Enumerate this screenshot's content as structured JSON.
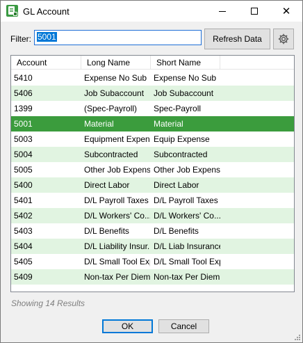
{
  "window": {
    "title": "GL Account",
    "icon": "gl-account-app-icon",
    "minimize_icon": "minimize-icon",
    "maximize_icon": "maximize-icon",
    "close_icon": "close-icon"
  },
  "filter": {
    "label": "Filter:",
    "value": "5001",
    "refresh_label": "Refresh Data",
    "settings_icon": "gear-icon"
  },
  "grid": {
    "columns": [
      "Account",
      "Long Name",
      "Short Name",
      ""
    ],
    "rows": [
      {
        "account": "5410",
        "long_name": "Expense No Sub",
        "short_name": "Expense No Sub"
      },
      {
        "account": "5406",
        "long_name": "Job Subaccount",
        "short_name": "Job Subaccount"
      },
      {
        "account": "1399",
        "long_name": "(Spec-Payroll)",
        "short_name": "Spec-Payroll"
      },
      {
        "account": "5001",
        "long_name": "Material",
        "short_name": "Material"
      },
      {
        "account": "5003",
        "long_name": "Equipment Expen...",
        "short_name": "Equip Expense"
      },
      {
        "account": "5004",
        "long_name": "Subcontracted",
        "short_name": "Subcontracted"
      },
      {
        "account": "5005",
        "long_name": "Other Job Expense",
        "short_name": "Other Job Expense"
      },
      {
        "account": "5400",
        "long_name": "Direct Labor",
        "short_name": "Direct Labor"
      },
      {
        "account": "5401",
        "long_name": "D/L Payroll Taxes",
        "short_name": "D/L Payroll Taxes"
      },
      {
        "account": "5402",
        "long_name": "D/L Workers' Co...",
        "short_name": "D/L Workers' Co..."
      },
      {
        "account": "5403",
        "long_name": "D/L Benefits",
        "short_name": "D/L Benefits"
      },
      {
        "account": "5404",
        "long_name": "D/L Liability Insur...",
        "short_name": "D/L Liab Insurance"
      },
      {
        "account": "5405",
        "long_name": "D/L Small Tool Exp",
        "short_name": "D/L Small Tool Exp"
      },
      {
        "account": "5409",
        "long_name": "Non-tax Per Diem",
        "short_name": "Non-tax Per Diem"
      }
    ],
    "selected_index": 3,
    "colors": {
      "alt_row": "#e1f4e1",
      "selected_row": "#3b9c3d"
    }
  },
  "status": {
    "results_text": "Showing 14 Results"
  },
  "buttons": {
    "ok_label": "OK",
    "cancel_label": "Cancel"
  }
}
